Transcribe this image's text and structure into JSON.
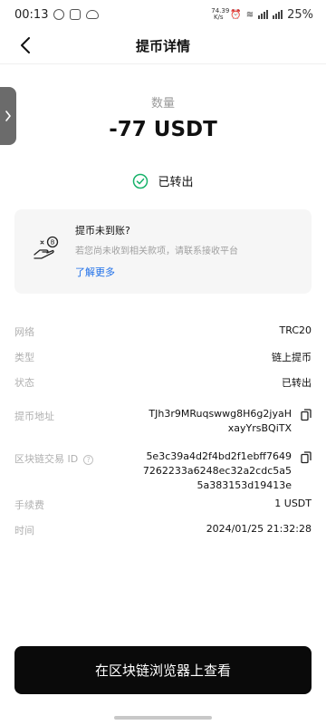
{
  "status_bar": {
    "time": "00:13",
    "speed_top": "74.39",
    "speed_bottom": "K/s",
    "battery": "25%"
  },
  "header": {
    "title": "提币详情"
  },
  "amount": {
    "label": "数量",
    "value": "-77 USDT"
  },
  "status": {
    "text": "已转出",
    "color": "#17b26a"
  },
  "notice": {
    "title": "提币未到账?",
    "description": "若您尚未收到相关款项，请联系接收平台",
    "link": "了解更多"
  },
  "details": {
    "network": {
      "label": "网络",
      "value": "TRC20"
    },
    "type": {
      "label": "类型",
      "value": "链上提币"
    },
    "state": {
      "label": "状态",
      "value": "已转出"
    },
    "address": {
      "label": "提币地址",
      "line1": "TJh3r9MRuqswwg8H6g2jyaH",
      "line2": "xayYrsBQiTX"
    },
    "txid": {
      "label": "区块链交易 ID",
      "line1": "5e3c39a4d2f4bd2f1ebff7649",
      "line2": "7262233a6248ec32a2cdc5a5",
      "line3": "5a383153d19413e"
    },
    "fee": {
      "label": "手续费",
      "value": "1 USDT"
    },
    "time": {
      "label": "时间",
      "value": "2024/01/25 21:32:28"
    }
  },
  "cta": {
    "label": "在区块链浏览器上查看"
  }
}
